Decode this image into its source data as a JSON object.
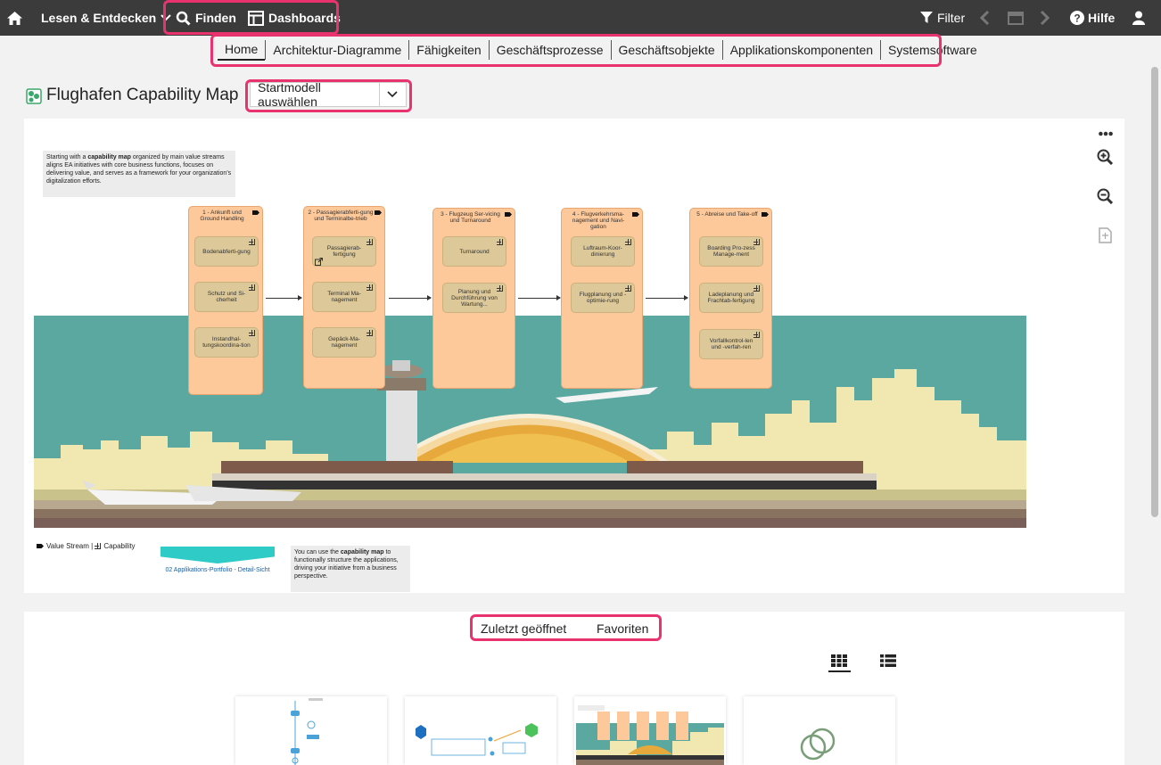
{
  "topbar": {
    "home_icon": "home-icon",
    "read_explore_label": "Lesen & Entdecken",
    "find_label": "Finden",
    "dashboards_label": "Dashboards",
    "filter_label": "Filter",
    "help_label": "Hilfe"
  },
  "nav": {
    "tabs": [
      {
        "label": "Home"
      },
      {
        "label": "Architektur-Diagramme"
      },
      {
        "label": "Fähigkeiten"
      },
      {
        "label": "Geschäftsprozesse"
      },
      {
        "label": "Geschäftsobjekte"
      },
      {
        "label": "Applikationskomponenten"
      },
      {
        "label": "Systemsoftware"
      }
    ]
  },
  "page": {
    "title": "Flughafen Capability Map",
    "start_model_label": "Startmodell auswählen"
  },
  "model": {
    "intro_pre": "Starting with a ",
    "intro_bold": "capability map",
    "intro_post": " organized by main value streams aligns EA initiatives with core business functions, focuses on delivering value, and serves as a framework for your organization's digitalization efforts.",
    "value_streams": [
      {
        "title": "1 - Ankunft und Ground Handling",
        "caps": [
          "Bodenabferti-gung",
          "Schutz und Si-cherheit",
          "Instandhal-tungskoordina-tion"
        ]
      },
      {
        "title": "2 - Passagierabferti-gung und Terminalbe-trieb",
        "caps": [
          "Passagierab-fertigung",
          "Terminal Ma-nagement",
          "Gepäck-Ma-nagement"
        ]
      },
      {
        "title": "3 - Flugzeug Ser-vicing und Turnaround",
        "caps": [
          "Turnaround",
          "Planung und Durchführung von Wartung..."
        ]
      },
      {
        "title": "4 - Flugverkehrsma-nagement und Navi-gation",
        "caps": [
          "Luftraum-Koor-dinierung",
          "Flugplanung und -optimie-rung"
        ]
      },
      {
        "title": "5 - Abreise und Take-off",
        "caps": [
          "Boarding Pro-zess Manage-ment",
          "Ladeplanung und Frachtab-fertigung",
          "Vorfallkontrol-len und -verfah-ren"
        ]
      }
    ],
    "legend_value_stream": "Value Stream",
    "legend_separator": " | ",
    "legend_capability": "Capability",
    "link_label": "02 Applikations-Portfolio - Detail-Sicht",
    "note_pre": "You can use the ",
    "note_bold": "capability map",
    "note_post": " to functionally structure the applications, driving your initiative from a business perspective."
  },
  "bottom": {
    "recent_label": "Zuletzt geöffnet",
    "favorites_label": "Favoriten"
  },
  "colors": {
    "topbar": "#3b3b3b",
    "highlight": "#e8336f",
    "value_stream": "#fdc89a",
    "capability": "#dcc898",
    "teal": "#5aa8a0",
    "sand": "#f1e7b0",
    "link_banner": "#2ecbc7"
  }
}
